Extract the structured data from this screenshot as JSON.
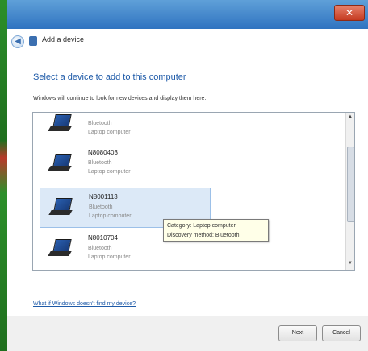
{
  "window": {
    "title": "Add a device",
    "close_glyph": "✕"
  },
  "page": {
    "heading": "Select a device to add to this computer",
    "subtext": "Windows will continue to look for new devices and display them here."
  },
  "devices": [
    {
      "name": "",
      "type": "Bluetooth",
      "category": "Laptop computer",
      "selected": false,
      "icon": "laptop-icon"
    },
    {
      "name": "N8080403",
      "type": "Bluetooth",
      "category": "Laptop computer",
      "selected": false,
      "icon": "laptop-icon"
    },
    {
      "name": "N8001113",
      "type": "Bluetooth",
      "category": "Laptop computer",
      "selected": true,
      "icon": "laptop-icon"
    },
    {
      "name": "N8010704",
      "type": "Bluetooth",
      "category": "Laptop computer",
      "selected": false,
      "icon": "laptop-icon"
    }
  ],
  "tooltip": {
    "category": "Category: Laptop computer",
    "method": "Discovery method: Bluetooth"
  },
  "help_link": "What if Windows doesn't find my device?",
  "buttons": {
    "next": "Next",
    "cancel": "Cancel"
  },
  "scrollbar": {
    "up_glyph": "▲",
    "down_glyph": "▼"
  }
}
